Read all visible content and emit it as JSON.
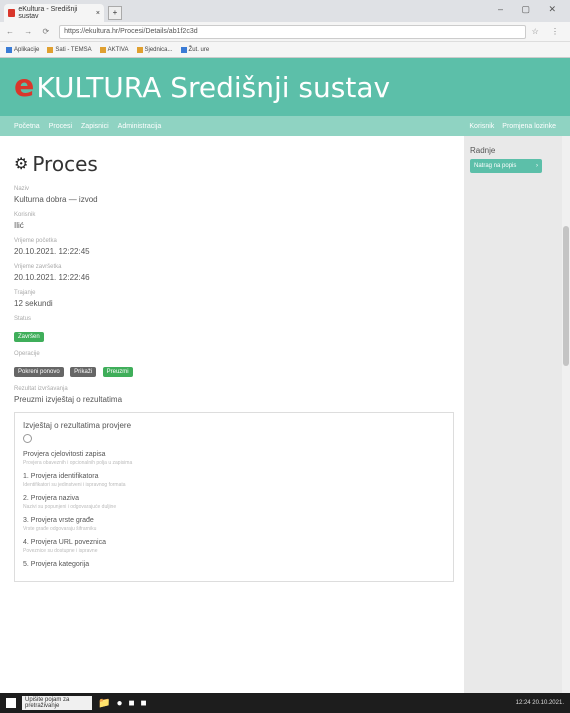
{
  "browser": {
    "tab_title": "eKultura - Središnji sustav",
    "url": "https://ekultura.hr/Procesi/Details/ab1f2c3d",
    "bookmarks": [
      {
        "label": "Aplikacije"
      },
      {
        "label": "Sati - TEMSA"
      },
      {
        "label": "AKTIVA"
      },
      {
        "label": "Sjednica..."
      },
      {
        "label": "Žut. ure"
      }
    ]
  },
  "header": {
    "logo_letter": "e",
    "logo_text": "KULTURA",
    "app_title": "Središnji sustav"
  },
  "nav": {
    "items": [
      "Početna",
      "Procesi",
      "Zapisnici",
      "Administracija"
    ],
    "right": [
      "Korisnik",
      "Promjena lozinke"
    ]
  },
  "page": {
    "title": "Proces",
    "fields": [
      {
        "label": "Naziv",
        "value": "Kulturna dobra — izvod"
      },
      {
        "label": "Korisnik",
        "value": "Ilić"
      },
      {
        "label": "Vrijeme početka",
        "value": "20.10.2021. 12:22:45"
      },
      {
        "label": "Vrijeme završetka",
        "value": "20.10.2021. 12:22:46"
      },
      {
        "label": "Trajanje",
        "value": "12 sekundi"
      }
    ],
    "status_label": "Status",
    "status_value": "Završen",
    "ops_label": "Operacije",
    "ops_badges": [
      "Pokreni ponovo",
      "Prikaži",
      "Preuzmi"
    ],
    "results_label": "Rezultat izvršavanja",
    "results_value": "Preuzmi izvještaj o rezultatima"
  },
  "box": {
    "title": "Izvještaj o rezultatima provjere",
    "options": [
      {
        "title": "Provjera cjelovitosti zapisa",
        "sub": "Provjera obaveznih i opcionalnih polja u zapisima"
      },
      {
        "title": "1. Provjera identifikatora",
        "sub": "Identifikatori su jedinstveni i ispravnog formata"
      },
      {
        "title": "2. Provjera naziva",
        "sub": "Nazivi su popunjeni i odgovarajuće duljine"
      },
      {
        "title": "3. Provjera vrste građe",
        "sub": "Vrste građe odgovaraju šifrarniku"
      },
      {
        "title": "4. Provjera URL poveznica",
        "sub": "Poveznice su dostupne i ispravne"
      },
      {
        "title": "5. Provjera kategorija",
        "sub": ""
      }
    ]
  },
  "sidebar": {
    "title": "Radnje",
    "button": "Natrag na popis"
  },
  "taskbar": {
    "search": "Upišite pojam za pretraživanje",
    "clock": "12:24 20.10.2021."
  }
}
